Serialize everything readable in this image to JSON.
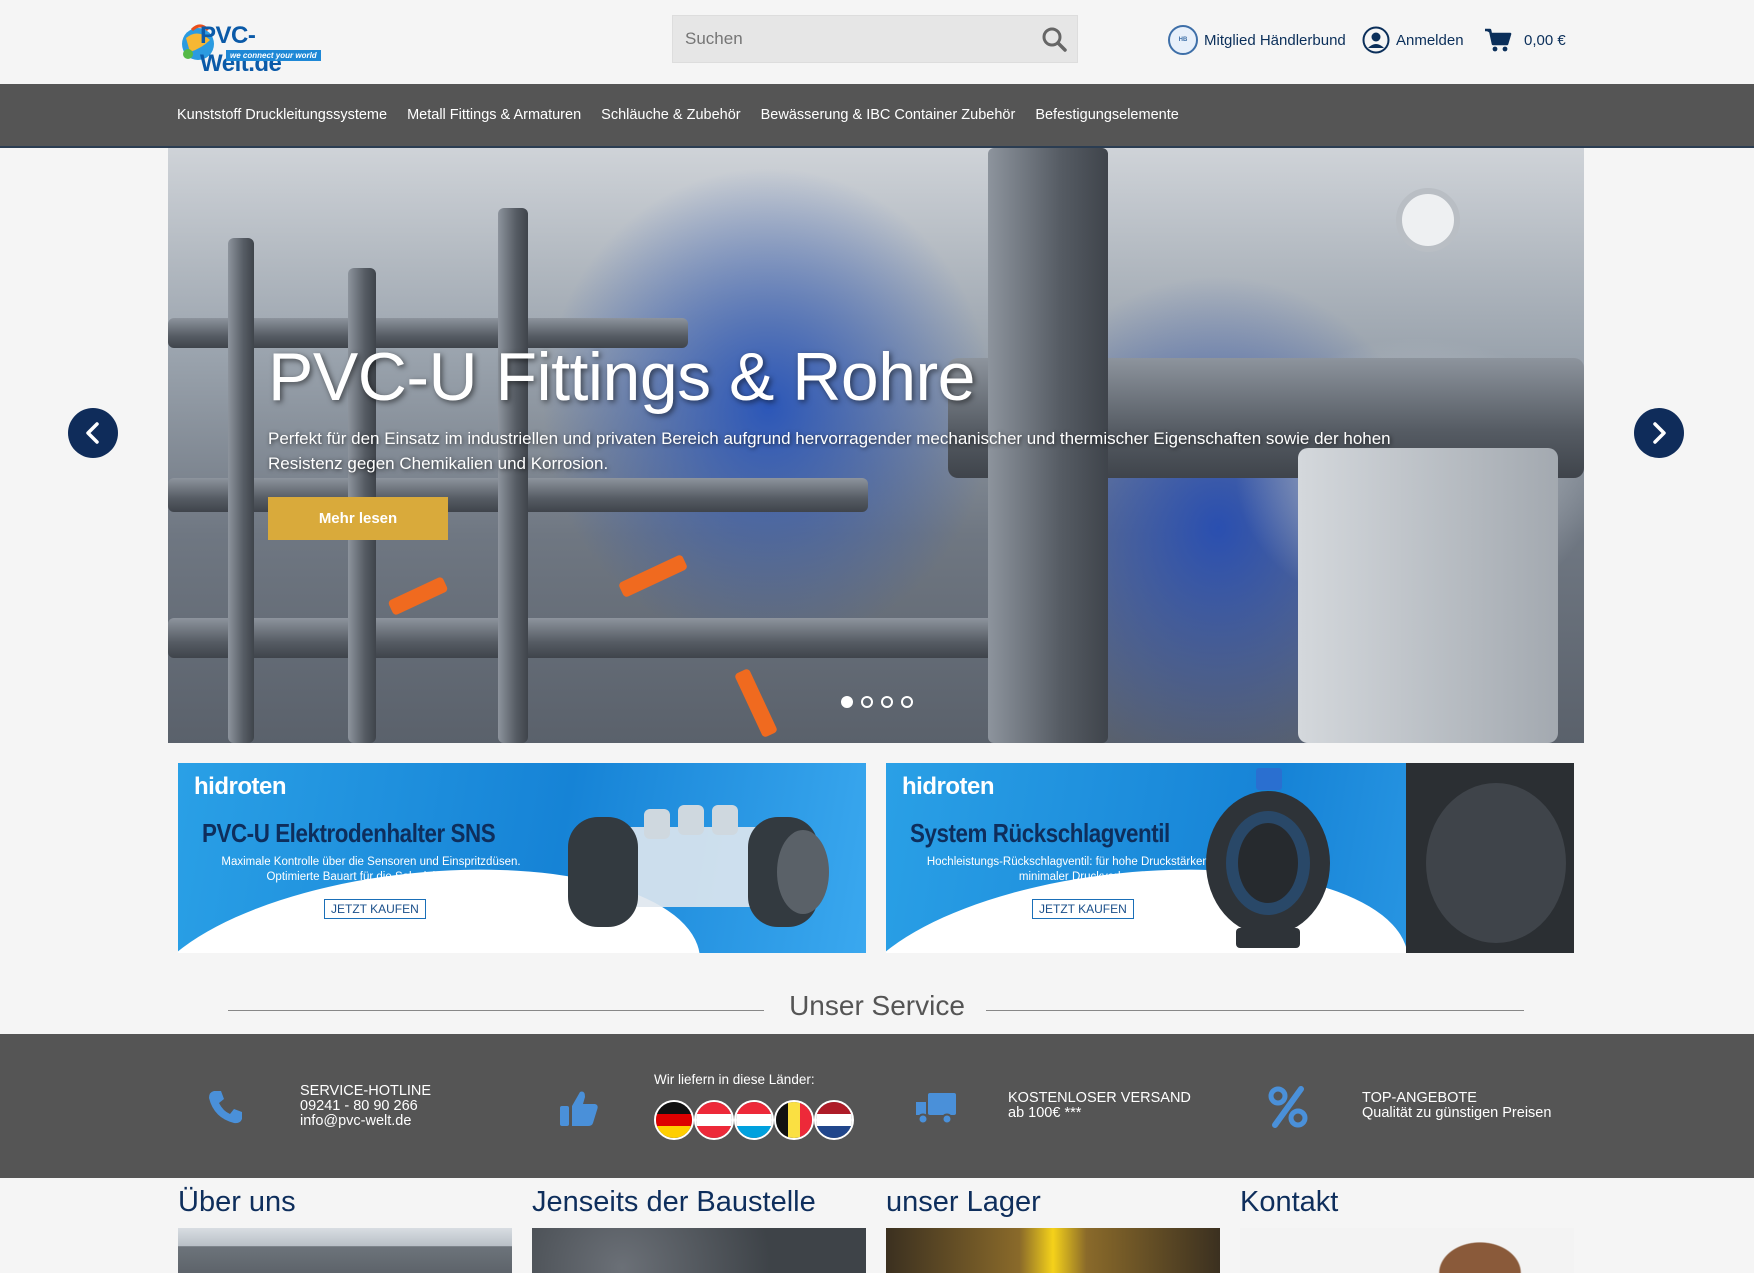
{
  "header": {
    "logo_text": "PVC-Welt.de",
    "logo_tagline": "we connect your world",
    "search_placeholder": "Suchen",
    "member_label": "Mitglied Händlerbund",
    "login_label": "Anmelden",
    "cart_total": "0,00 €"
  },
  "nav": {
    "items": [
      {
        "label": "Kunststoff Druckleitungssysteme"
      },
      {
        "label": "Metall Fittings & Armaturen"
      },
      {
        "label": "Schläuche & Zubehör"
      },
      {
        "label": "Bewässerung & IBC Container Zubehör"
      },
      {
        "label": "Befestigungselemente"
      }
    ]
  },
  "hero": {
    "title": "PVC-U Fittings & Rohre",
    "text": "Perfekt für den Einsatz im industriellen und privaten Bereich aufgrund hervorragender mechanischer und thermischer Eigenschaften sowie der hohen Resistenz gegen Chemikalien und Korrosion.",
    "button_label": "Mehr lesen",
    "slide_count": 4,
    "active_slide": 1
  },
  "banners": [
    {
      "brand": "hidroten",
      "title": "PVC-U Elektrodenhalter SNS",
      "sub": "Maximale Kontrolle über die Sensoren und Einspritzdüsen. Optimierte Bauart für die Salzelektrolyse.",
      "cta": "JETZT KAUFEN"
    },
    {
      "brand": "hidroten",
      "title": "System Rückschlagventil",
      "sub": "Hochleistungs-Rückschlagventil: für hohe Druckstärken und minimaler Druckverlust.",
      "cta": "JETZT KAUFEN"
    }
  ],
  "service": {
    "heading": "Unser Service",
    "hotline_title": "SERVICE-HOTLINE",
    "hotline_phone": "09241 - 80 90 266",
    "hotline_email": "info@pvc-welt.de",
    "countries_label": "Wir liefern in diese Länder:",
    "shipping_text": "KOSTENLOSER VERSAND ab 100€ ***",
    "offers_title": "TOP-ANGEBOTE",
    "offers_sub": "Qualität zu günstigen Preisen",
    "accent_color": "#4a90d9"
  },
  "bottom": {
    "columns": [
      {
        "title": "Über uns"
      },
      {
        "title": "Jenseits der Baustelle"
      },
      {
        "title": "unser Lager"
      },
      {
        "title": "Kontakt"
      }
    ]
  }
}
